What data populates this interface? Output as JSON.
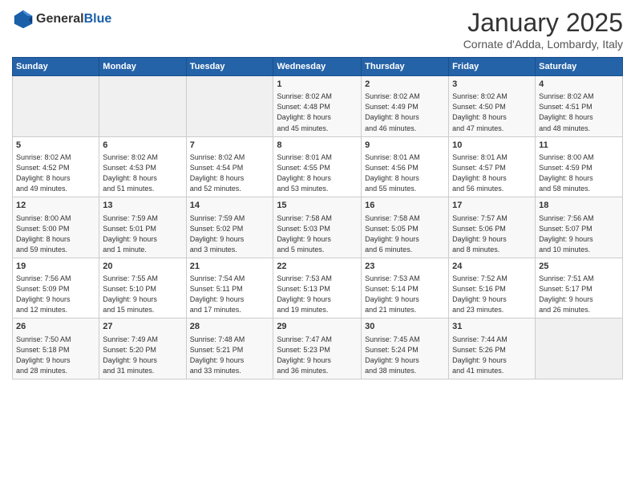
{
  "header": {
    "logo_line1": "General",
    "logo_line2": "Blue",
    "month_title": "January 2025",
    "location": "Cornate d'Adda, Lombardy, Italy"
  },
  "weekdays": [
    "Sunday",
    "Monday",
    "Tuesday",
    "Wednesday",
    "Thursday",
    "Friday",
    "Saturday"
  ],
  "weeks": [
    [
      {
        "day": "",
        "info": ""
      },
      {
        "day": "",
        "info": ""
      },
      {
        "day": "",
        "info": ""
      },
      {
        "day": "1",
        "info": "Sunrise: 8:02 AM\nSunset: 4:48 PM\nDaylight: 8 hours\nand 45 minutes."
      },
      {
        "day": "2",
        "info": "Sunrise: 8:02 AM\nSunset: 4:49 PM\nDaylight: 8 hours\nand 46 minutes."
      },
      {
        "day": "3",
        "info": "Sunrise: 8:02 AM\nSunset: 4:50 PM\nDaylight: 8 hours\nand 47 minutes."
      },
      {
        "day": "4",
        "info": "Sunrise: 8:02 AM\nSunset: 4:51 PM\nDaylight: 8 hours\nand 48 minutes."
      }
    ],
    [
      {
        "day": "5",
        "info": "Sunrise: 8:02 AM\nSunset: 4:52 PM\nDaylight: 8 hours\nand 49 minutes."
      },
      {
        "day": "6",
        "info": "Sunrise: 8:02 AM\nSunset: 4:53 PM\nDaylight: 8 hours\nand 51 minutes."
      },
      {
        "day": "7",
        "info": "Sunrise: 8:02 AM\nSunset: 4:54 PM\nDaylight: 8 hours\nand 52 minutes."
      },
      {
        "day": "8",
        "info": "Sunrise: 8:01 AM\nSunset: 4:55 PM\nDaylight: 8 hours\nand 53 minutes."
      },
      {
        "day": "9",
        "info": "Sunrise: 8:01 AM\nSunset: 4:56 PM\nDaylight: 8 hours\nand 55 minutes."
      },
      {
        "day": "10",
        "info": "Sunrise: 8:01 AM\nSunset: 4:57 PM\nDaylight: 8 hours\nand 56 minutes."
      },
      {
        "day": "11",
        "info": "Sunrise: 8:00 AM\nSunset: 4:59 PM\nDaylight: 8 hours\nand 58 minutes."
      }
    ],
    [
      {
        "day": "12",
        "info": "Sunrise: 8:00 AM\nSunset: 5:00 PM\nDaylight: 8 hours\nand 59 minutes."
      },
      {
        "day": "13",
        "info": "Sunrise: 7:59 AM\nSunset: 5:01 PM\nDaylight: 9 hours\nand 1 minute."
      },
      {
        "day": "14",
        "info": "Sunrise: 7:59 AM\nSunset: 5:02 PM\nDaylight: 9 hours\nand 3 minutes."
      },
      {
        "day": "15",
        "info": "Sunrise: 7:58 AM\nSunset: 5:03 PM\nDaylight: 9 hours\nand 5 minutes."
      },
      {
        "day": "16",
        "info": "Sunrise: 7:58 AM\nSunset: 5:05 PM\nDaylight: 9 hours\nand 6 minutes."
      },
      {
        "day": "17",
        "info": "Sunrise: 7:57 AM\nSunset: 5:06 PM\nDaylight: 9 hours\nand 8 minutes."
      },
      {
        "day": "18",
        "info": "Sunrise: 7:56 AM\nSunset: 5:07 PM\nDaylight: 9 hours\nand 10 minutes."
      }
    ],
    [
      {
        "day": "19",
        "info": "Sunrise: 7:56 AM\nSunset: 5:09 PM\nDaylight: 9 hours\nand 12 minutes."
      },
      {
        "day": "20",
        "info": "Sunrise: 7:55 AM\nSunset: 5:10 PM\nDaylight: 9 hours\nand 15 minutes."
      },
      {
        "day": "21",
        "info": "Sunrise: 7:54 AM\nSunset: 5:11 PM\nDaylight: 9 hours\nand 17 minutes."
      },
      {
        "day": "22",
        "info": "Sunrise: 7:53 AM\nSunset: 5:13 PM\nDaylight: 9 hours\nand 19 minutes."
      },
      {
        "day": "23",
        "info": "Sunrise: 7:53 AM\nSunset: 5:14 PM\nDaylight: 9 hours\nand 21 minutes."
      },
      {
        "day": "24",
        "info": "Sunrise: 7:52 AM\nSunset: 5:16 PM\nDaylight: 9 hours\nand 23 minutes."
      },
      {
        "day": "25",
        "info": "Sunrise: 7:51 AM\nSunset: 5:17 PM\nDaylight: 9 hours\nand 26 minutes."
      }
    ],
    [
      {
        "day": "26",
        "info": "Sunrise: 7:50 AM\nSunset: 5:18 PM\nDaylight: 9 hours\nand 28 minutes."
      },
      {
        "day": "27",
        "info": "Sunrise: 7:49 AM\nSunset: 5:20 PM\nDaylight: 9 hours\nand 31 minutes."
      },
      {
        "day": "28",
        "info": "Sunrise: 7:48 AM\nSunset: 5:21 PM\nDaylight: 9 hours\nand 33 minutes."
      },
      {
        "day": "29",
        "info": "Sunrise: 7:47 AM\nSunset: 5:23 PM\nDaylight: 9 hours\nand 36 minutes."
      },
      {
        "day": "30",
        "info": "Sunrise: 7:45 AM\nSunset: 5:24 PM\nDaylight: 9 hours\nand 38 minutes."
      },
      {
        "day": "31",
        "info": "Sunrise: 7:44 AM\nSunset: 5:26 PM\nDaylight: 9 hours\nand 41 minutes."
      },
      {
        "day": "",
        "info": ""
      }
    ]
  ]
}
